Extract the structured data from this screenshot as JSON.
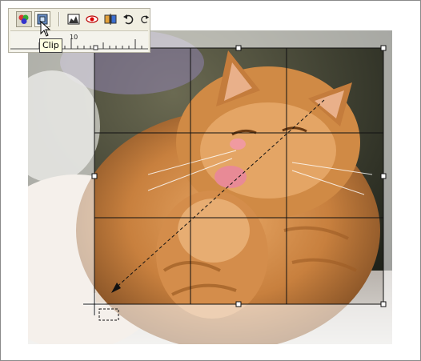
{
  "toolbar": {
    "buttons": [
      {
        "name": "color-adjust-icon",
        "label": ""
      },
      {
        "name": "clip-icon",
        "label": ""
      },
      {
        "name": "histogram-icon",
        "label": ""
      },
      {
        "name": "red-eye-icon",
        "label": ""
      },
      {
        "name": "mirror-icon",
        "label": ""
      },
      {
        "name": "rotate-left-icon",
        "label": ""
      },
      {
        "name": "rotate-right-icon",
        "label": ""
      }
    ],
    "ruler_label": "10"
  },
  "tooltip": {
    "text": "Clip"
  },
  "colors": {
    "toolbar_bg": "#f1efe2",
    "tooltip_bg": "#ffffe1",
    "crop_line": "#111111"
  },
  "crop_grid": {
    "rows": 3,
    "columns": 3
  }
}
